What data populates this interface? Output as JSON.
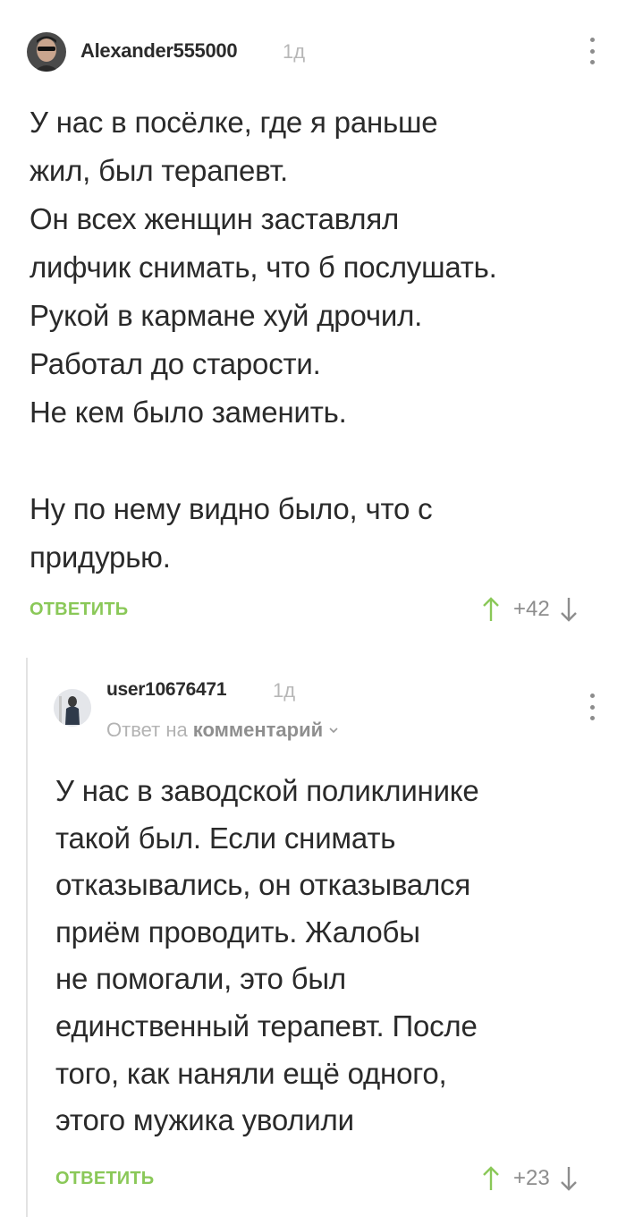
{
  "comments": [
    {
      "author": "Alexander555000",
      "time": "1д",
      "text": "У нас в посёлке, где я раньше\nжил, был терапевт.\nОн всех женщин заставлял\nлифчик снимать, что б послушать.\nРукой в кармане хуй дрочил.\nРаботал до старости.\nНе кем было заменить.\n\nНу по нему видно было, что с\nпридурью.",
      "reply_label": "ОТВЕТИТЬ",
      "rating": "+42"
    },
    {
      "author": "user10676471",
      "time": "1д",
      "reply_to_prefix": "Ответ на",
      "reply_to_link": "комментарий",
      "text": "У нас в заводской поликлинике\nтакой был. Если снимать\nотказывались, он отказывался\nприём проводить. Жалобы\nне помогали, это был\nединственный терапевт. После\nтого, как наняли ещё одного,\nэтого мужика уволили",
      "reply_label": "ОТВЕТИТЬ",
      "rating": "+23"
    }
  ],
  "colors": {
    "accent_green": "#8ac858",
    "muted": "#8d8d8d",
    "text": "#2a2a2a",
    "thread_line": "#e3e3e3"
  }
}
